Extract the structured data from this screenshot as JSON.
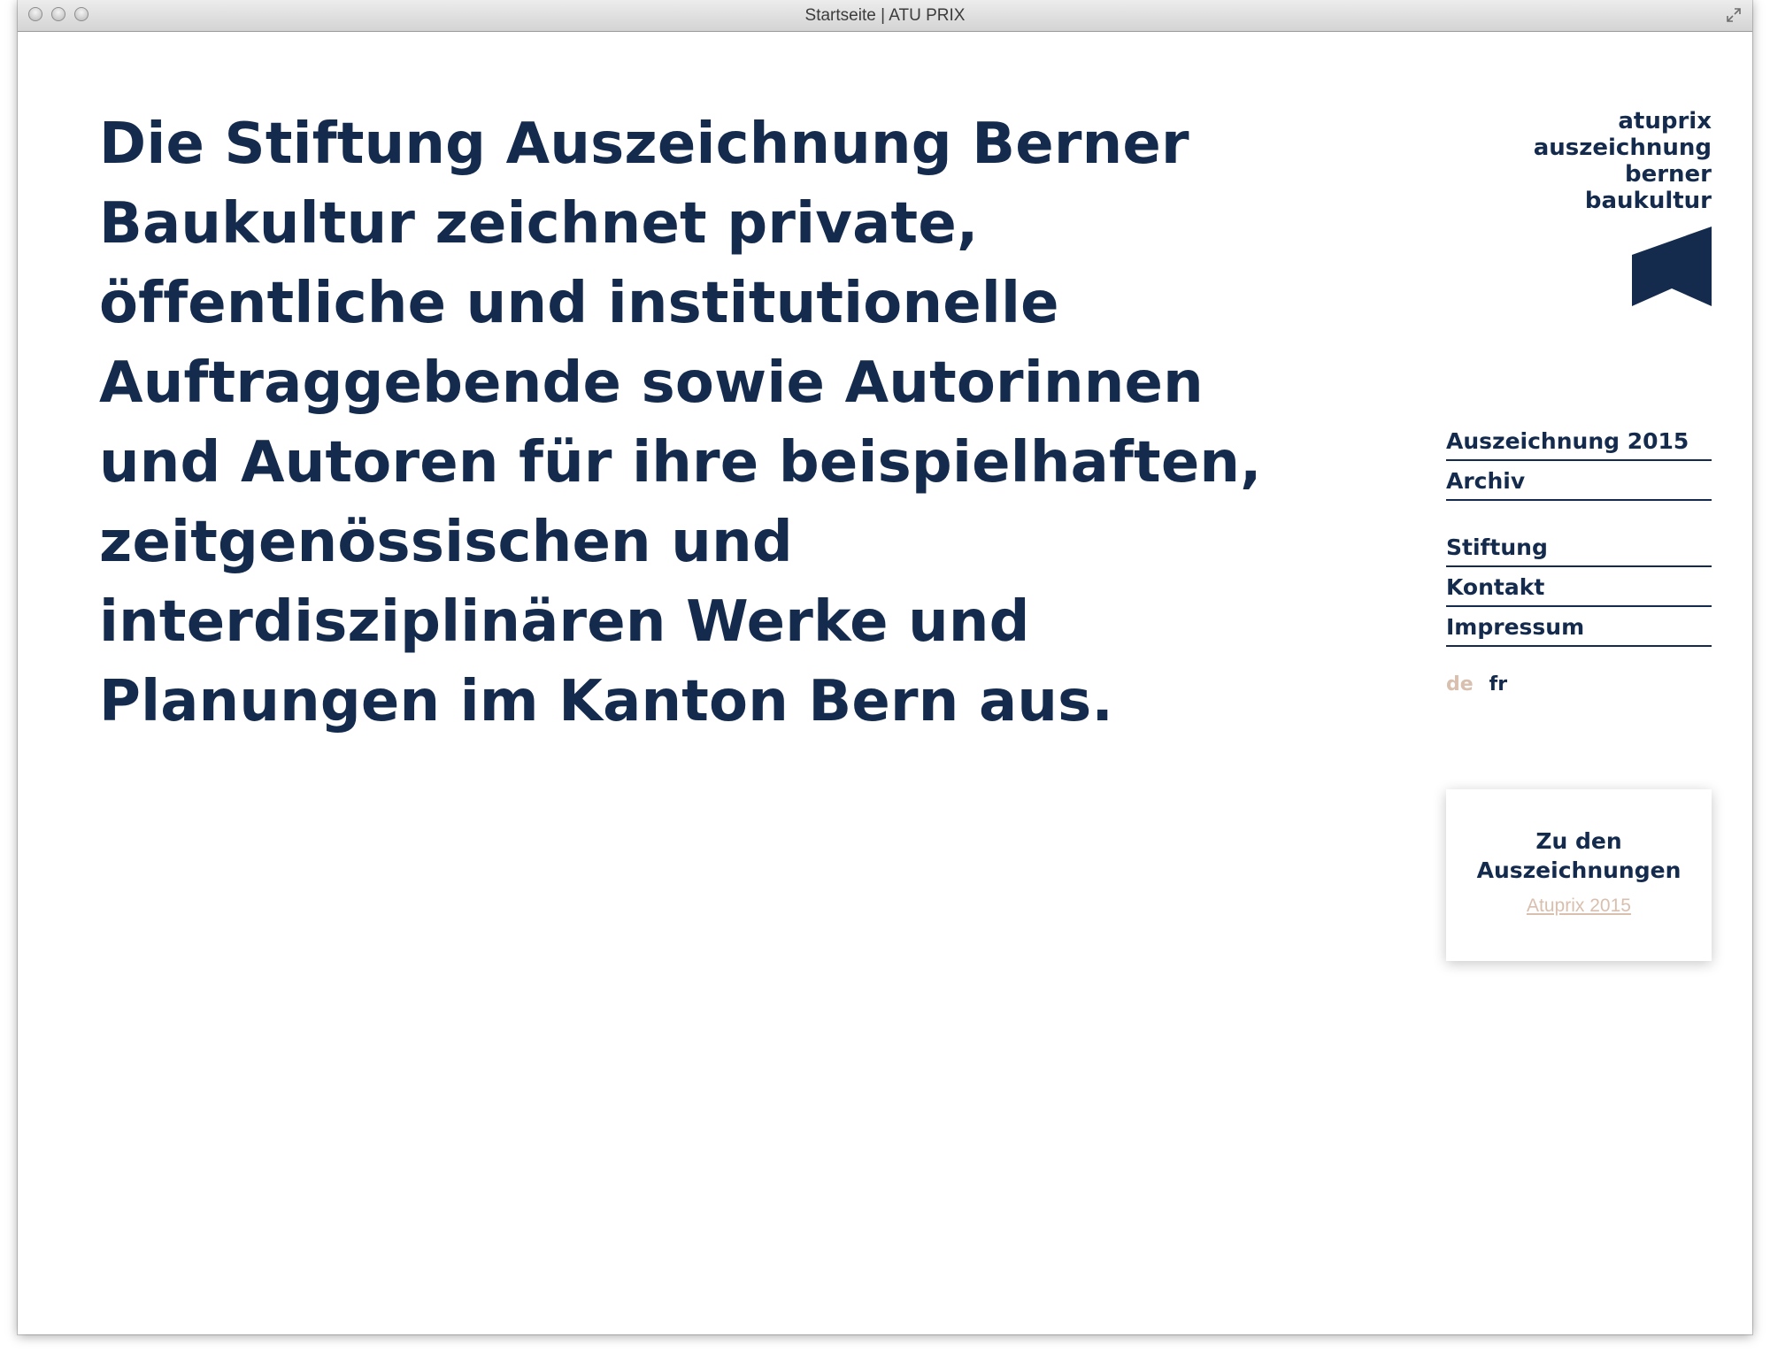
{
  "window": {
    "title": "Startseite | ATU PRIX"
  },
  "hero": {
    "lines": [
      "Die Stiftung Auszeichnung Berner",
      "Baukultur zeichnet private,",
      "öffentliche und institutionelle",
      "Auftraggebende sowie Autorinnen",
      "und Autoren für ihre beispielhaften,",
      "zeitgenössischen und",
      "interdisziplinären Werke und",
      "Planungen im Kanton Bern aus."
    ]
  },
  "brand": {
    "lines": [
      "atuprix",
      "auszeichnung",
      "berner",
      "baukultur"
    ],
    "color": "#142b4d"
  },
  "nav": {
    "primary": [
      "Auszeichnung 2015",
      "Archiv"
    ],
    "secondary": [
      "Stiftung",
      "Kontakt",
      "Impressum"
    ]
  },
  "language": {
    "active": "de",
    "other": "fr",
    "active_color": "#d8bfae"
  },
  "promo": {
    "title_lines": [
      "Zu den",
      "Auszeichnungen"
    ],
    "link": "Atuprix 2015"
  }
}
